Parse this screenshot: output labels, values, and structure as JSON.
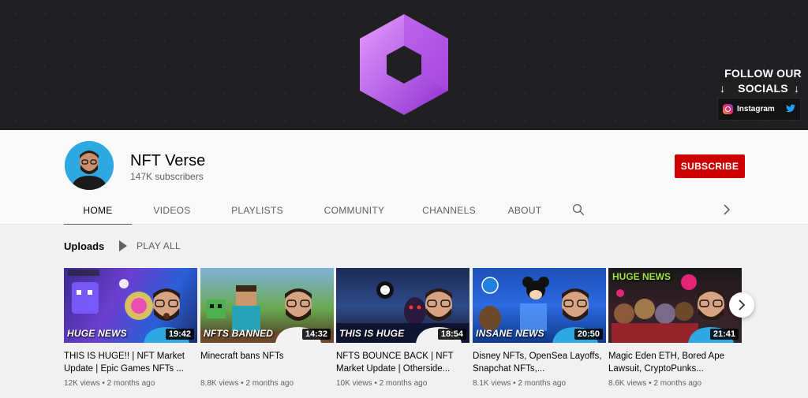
{
  "banner": {
    "follow_text": "FOLLOW OUR SOCIALS",
    "instagram_label": "Instagram",
    "logo_icon": "hexagon-logo-icon",
    "colors": {
      "logo_light": "#d580f5",
      "logo_dark": "#9b3fd6"
    }
  },
  "channel": {
    "name": "NFT Verse",
    "subscribers": "147K subscribers",
    "subscribe_label": "SUBSCRIBE"
  },
  "tabs": [
    {
      "label": "HOME",
      "active": true
    },
    {
      "label": "VIDEOS"
    },
    {
      "label": "PLAYLISTS"
    },
    {
      "label": "COMMUNITY"
    },
    {
      "label": "CHANNELS"
    },
    {
      "label": "ABOUT"
    }
  ],
  "uploads": {
    "title": "Uploads",
    "play_all": "PLAY ALL"
  },
  "videos": [
    {
      "banner": "HUGE NEWS",
      "duration": "19:42",
      "title": "THIS IS HUGE!! | NFT Market Update | Epic Games NFTs ...",
      "views": "12K views",
      "age": "2 months ago"
    },
    {
      "banner": "NFTS BANNED",
      "duration": "14:32",
      "title": "Minecraft bans NFTs",
      "views": "8.8K views",
      "age": "2 months ago"
    },
    {
      "banner": "THIS IS HUGE",
      "duration": "18:54",
      "title": "NFTS BOUNCE BACK | NFT Market Update | Otherside...",
      "views": "10K views",
      "age": "2 months ago"
    },
    {
      "banner": "INSANE NEWS",
      "duration": "20:50",
      "title": "Disney NFTs, OpenSea Layoffs, Snapchat NFTs,...",
      "views": "8.1K views",
      "age": "2 months ago"
    },
    {
      "banner": "HUGE NEWS",
      "duration": "21:41",
      "title": "Magic Eden ETH, Bored Ape Lawsuit, CryptoPunks...",
      "views": "8.6K views",
      "age": "2 months ago"
    }
  ],
  "meta_separator": "•"
}
